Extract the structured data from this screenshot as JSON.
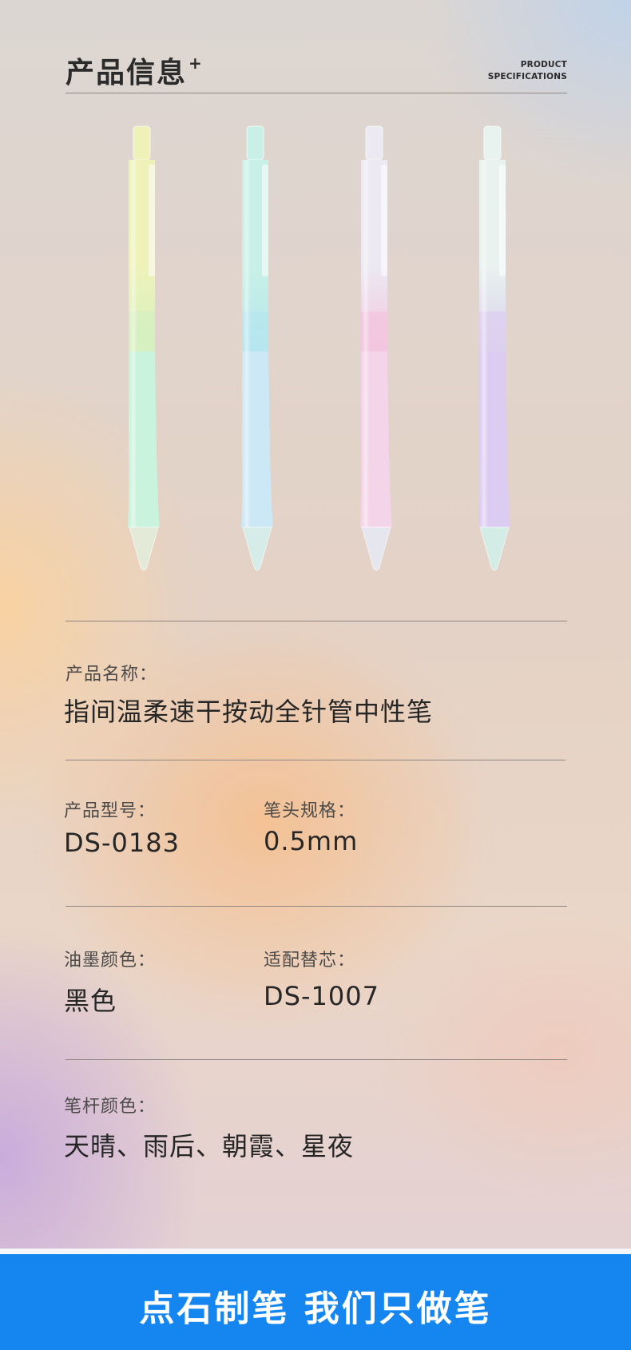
{
  "header": {
    "title": "产品信息",
    "title_mark": "+",
    "subtitle_line1": "PRODUCT",
    "subtitle_line2": "SPECIFICATIONS"
  },
  "pens": [
    {
      "top": "#eef2b8",
      "upper": "#d6f0c0",
      "grip": "#c9f3dc",
      "tip": "#e3ead8"
    },
    {
      "top": "#c8f0e6",
      "upper": "#b6e6ef",
      "grip": "#cce8f6",
      "tip": "#d6ece8"
    },
    {
      "top": "#ece9f2",
      "upper": "#f2c6de",
      "grip": "#f4d4e8",
      "tip": "#e6e6ef"
    },
    {
      "top": "#e8f2ee",
      "upper": "#dcd0ef",
      "grip": "#ddccf2",
      "tip": "#d4ece6"
    }
  ],
  "specs": {
    "name_label": "产品名称：",
    "name_value": "指间温柔速干按动全针管中性笔",
    "model_label": "产品型号：",
    "model_value": "DS-0183",
    "tip_label": "笔头规格：",
    "tip_value": "0.5mm",
    "ink_label": "油墨颜色：",
    "ink_value": "黑色",
    "refill_label": "适配替芯：",
    "refill_value": "DS-1007",
    "barrel_label": "笔杆颜色：",
    "barrel_value": "天晴、雨后、朝霞、星夜"
  },
  "footer": {
    "slogan": "点石制笔  我们只做笔",
    "background": "#1586f0"
  }
}
